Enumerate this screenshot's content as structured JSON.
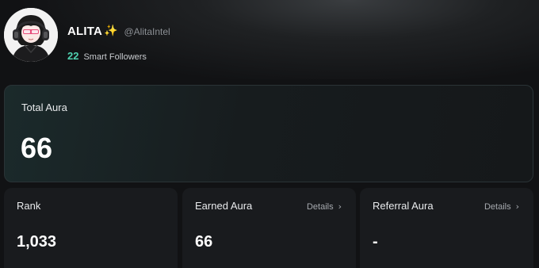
{
  "profile": {
    "name": "ALITA",
    "sparkle_icon": "✨",
    "handle": "@AlitaIntel",
    "followers_count": "22",
    "followers_label": "Smart Followers",
    "avatar_icon": "anime-girl-headphones-avatar"
  },
  "total_aura": {
    "label": "Total Aura",
    "value": "66"
  },
  "stats": {
    "rank": {
      "label": "Rank",
      "value": "1,033"
    },
    "earned": {
      "label": "Earned Aura",
      "value": "66",
      "details_label": "Details",
      "details_icon": "chevron-right-icon"
    },
    "referral": {
      "label": "Referral Aura",
      "value": "-",
      "details_label": "Details",
      "details_icon": "chevron-right-icon"
    }
  },
  "colors": {
    "background": "#111214",
    "accent_teal": "#4fd1b0",
    "card": "#191b1e",
    "sparkle": "#f6c945"
  }
}
